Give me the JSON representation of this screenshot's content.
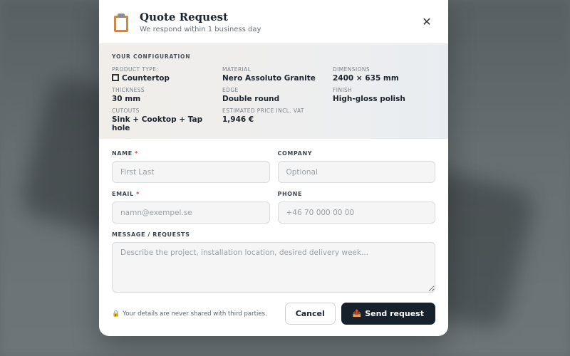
{
  "modal": {
    "title": "Quote Request",
    "subtitle": "We respond within 1 business day",
    "close_icon": "close-icon"
  },
  "config": {
    "heading": "YOUR CONFIGURATION",
    "items": [
      {
        "label": "PRODUCT TYPE:",
        "value": "Countertop",
        "icon": "square-icon"
      },
      {
        "label": "MATERIAL",
        "value": "Nero Assoluto Granite"
      },
      {
        "label": "DIMENSIONS",
        "value": "2400 × 635 mm"
      },
      {
        "label": "THICKNESS",
        "value": "30 mm"
      },
      {
        "label": "EDGE",
        "value": "Double round"
      },
      {
        "label": "FINISH",
        "value": "High-gloss polish"
      },
      {
        "label": "CUTOUTS",
        "value": "Sink + Cooktop + Tap hole"
      },
      {
        "label": "ESTIMATED PRICE INCL. VAT",
        "value": "1,946 €"
      }
    ]
  },
  "form": {
    "name": {
      "label": "NAME",
      "required_mark": "*",
      "placeholder": "First Last",
      "value": ""
    },
    "company": {
      "label": "COMPANY",
      "placeholder": "Optional",
      "value": ""
    },
    "email": {
      "label": "EMAIL",
      "required_mark": "*",
      "placeholder": "namn@exempel.se",
      "value": ""
    },
    "phone": {
      "label": "PHONE",
      "placeholder": "+46 70 000 00 00",
      "value": ""
    },
    "message": {
      "label": "MESSAGE / REQUESTS",
      "placeholder": "Describe the project, installation location, desired delivery week...",
      "value": ""
    }
  },
  "footer": {
    "privacy_text": "Your details are never shared with third parties.",
    "privacy_icon": "lock-icon",
    "cancel_label": "Cancel",
    "send_label": "Send request",
    "send_icon": "outbox-tray-icon"
  },
  "colors": {
    "primary_button": "#17212b",
    "required": "#d23b3b",
    "title": "#1c2530"
  }
}
